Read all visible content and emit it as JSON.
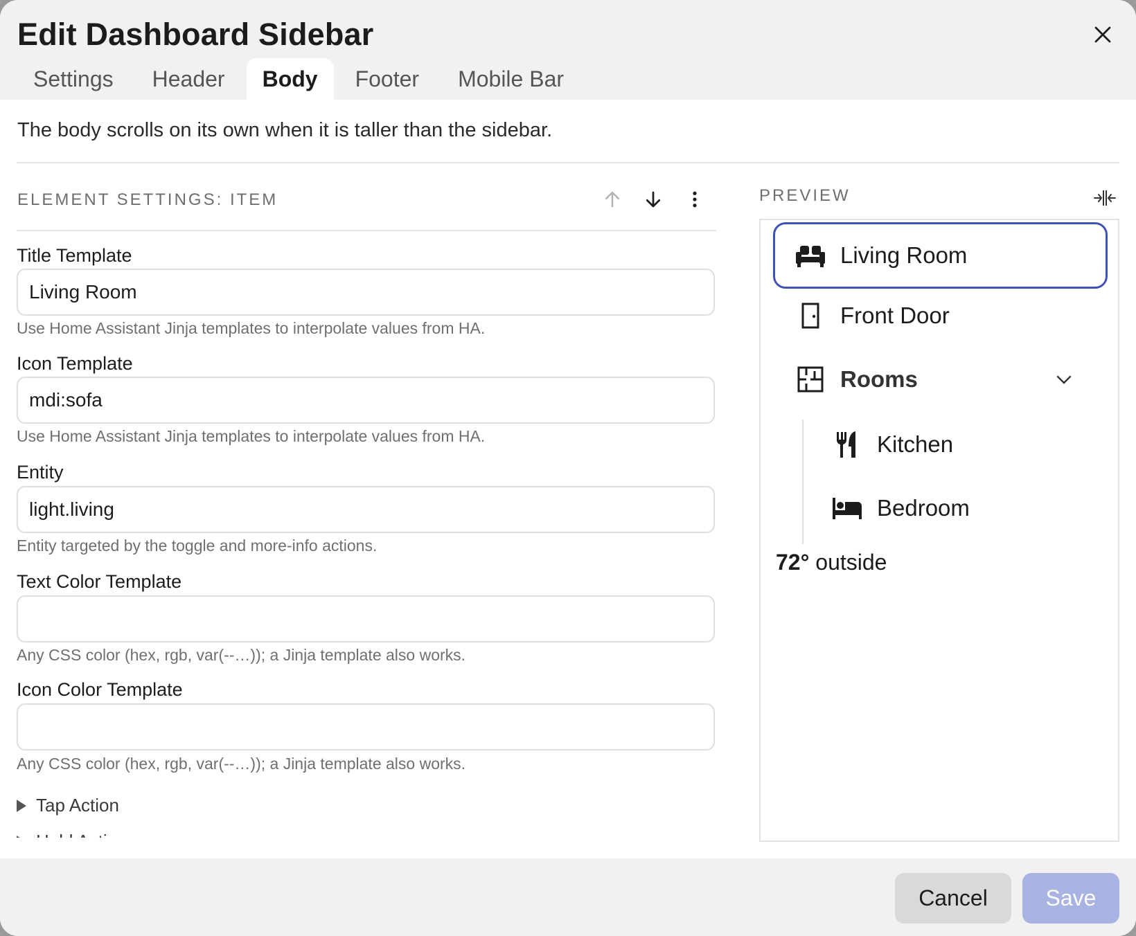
{
  "dialog": {
    "title": "Edit Dashboard Sidebar"
  },
  "tabs": [
    {
      "label": "Settings",
      "active": false
    },
    {
      "label": "Header",
      "active": false
    },
    {
      "label": "Body",
      "active": true
    },
    {
      "label": "Footer",
      "active": false
    },
    {
      "label": "Mobile Bar",
      "active": false
    }
  ],
  "intro": "The body scrolls on its own when it is taller than the sidebar.",
  "element_settings": {
    "section_label": "ELEMENT SETTINGS: ITEM",
    "fields": [
      {
        "label": "Title Template",
        "value": "Living Room",
        "help": "Use Home Assistant Jinja templates to interpolate values from HA."
      },
      {
        "label": "Icon Template",
        "value": "mdi:sofa",
        "help": "Use Home Assistant Jinja templates to interpolate values from HA."
      },
      {
        "label": "Entity",
        "value": "light.living",
        "help": "Entity targeted by the toggle and more-info actions."
      },
      {
        "label": "Text Color Template",
        "value": "",
        "help": "Any CSS color (hex, rgb, var(--…)); a Jinja template also works."
      },
      {
        "label": "Icon Color Template",
        "value": "",
        "help": "Any CSS color (hex, rgb, var(--…)); a Jinja template also works."
      }
    ],
    "disclosures": [
      "Tap Action",
      "Hold Action"
    ]
  },
  "preview": {
    "label": "PREVIEW",
    "items": [
      {
        "label": "Living Room",
        "icon": "sofa-icon",
        "selected": true
      },
      {
        "label": "Front Door",
        "icon": "door-icon"
      },
      {
        "label": "Rooms",
        "icon": "floor-plan-icon",
        "group": true
      },
      {
        "label": "Kitchen",
        "icon": "silverware-icon"
      },
      {
        "label": "Bedroom",
        "icon": "bed-icon"
      }
    ],
    "weather": {
      "temp": "72°",
      "text": "outside"
    }
  },
  "footer": {
    "cancel_label": "Cancel",
    "save_label": "Save"
  },
  "colors": {
    "accent": "#3f51b5",
    "save_disabled": "#a8b3e2",
    "panel_bg": "#f1f1f1"
  }
}
